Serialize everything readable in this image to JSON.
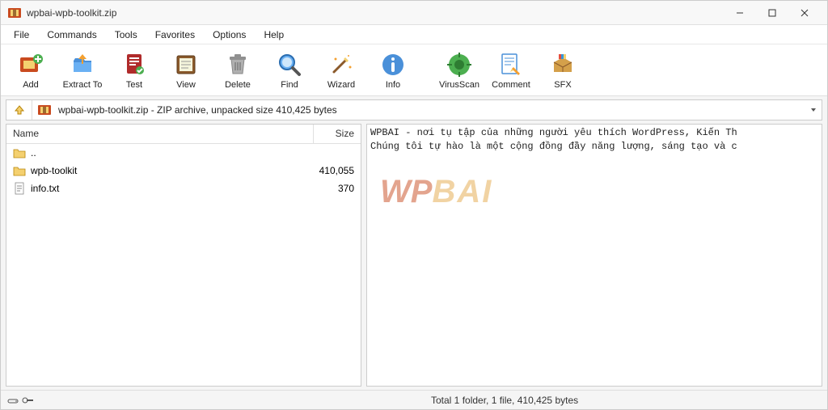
{
  "window": {
    "title": "wpbai-wpb-toolkit.zip"
  },
  "menu": [
    "File",
    "Commands",
    "Tools",
    "Favorites",
    "Options",
    "Help"
  ],
  "toolbar": [
    {
      "key": "add",
      "label": "Add"
    },
    {
      "key": "extract",
      "label": "Extract To"
    },
    {
      "key": "test",
      "label": "Test"
    },
    {
      "key": "view",
      "label": "View"
    },
    {
      "key": "delete",
      "label": "Delete"
    },
    {
      "key": "find",
      "label": "Find"
    },
    {
      "key": "wizard",
      "label": "Wizard"
    },
    {
      "key": "info",
      "label": "Info"
    },
    {
      "key": "virusscan",
      "label": "VirusScan"
    },
    {
      "key": "comment",
      "label": "Comment"
    },
    {
      "key": "sfx",
      "label": "SFX"
    }
  ],
  "address": {
    "path": "wpbai-wpb-toolkit.zip - ZIP archive, unpacked size 410,425 bytes"
  },
  "columns": {
    "name": "Name",
    "size": "Size"
  },
  "files": [
    {
      "icon": "folder-up",
      "name": "..",
      "size": ""
    },
    {
      "icon": "folder",
      "name": "wpb-toolkit",
      "size": "410,055"
    },
    {
      "icon": "text",
      "name": "info.txt",
      "size": "370"
    }
  ],
  "preview": {
    "line1": "WPBAI - nơi tụ tập của những người yêu thích WordPress, Kiến Th",
    "line2": "Chúng tôi tự hào là một cộng đồng đầy năng lượng, sáng tạo và c"
  },
  "status": {
    "text": "Total 1 folder, 1 file, 410,425 bytes"
  },
  "watermark": {
    "part1": "WP",
    "part2": "BAI"
  }
}
